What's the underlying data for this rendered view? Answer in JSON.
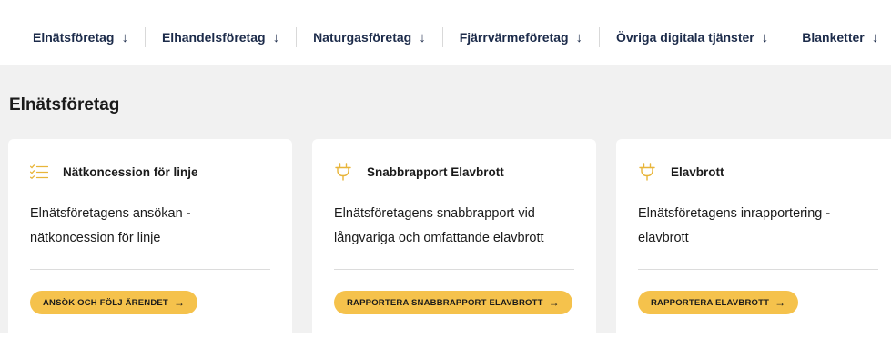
{
  "nav": {
    "items": [
      {
        "label": "Elnätsföretag",
        "icon": "arrow-down-icon"
      },
      {
        "label": "Elhandelsföretag",
        "icon": "arrow-down-icon"
      },
      {
        "label": "Naturgasföretag",
        "icon": "arrow-down-icon"
      },
      {
        "label": "Fjärrvärmeföretag",
        "icon": "arrow-down-icon"
      },
      {
        "label": "Övriga digitala tjänster",
        "icon": "arrow-down-icon"
      },
      {
        "label": "Blanketter",
        "icon": "arrow-down-icon"
      }
    ],
    "arrow_glyph": "↓"
  },
  "section": {
    "title": "Elnätsföretag"
  },
  "cards": [
    {
      "icon": "checklist-icon",
      "title": "Nätkoncession för linje",
      "description": "Elnätsföretagens ansökan - nätkoncession för linje",
      "button": "ANSÖK OCH FÖLJ ÄRENDET",
      "button_arrow": "→"
    },
    {
      "icon": "plug-icon",
      "title": "Snabbrapport Elavbrott",
      "description": "Elnätsföretagens snabbrapport vid långvariga och omfattande elavbrott",
      "button": "RAPPORTERA SNABBRAPPORT ELAVBROTT",
      "button_arrow": "→"
    },
    {
      "icon": "plug-icon",
      "title": "Elavbrott",
      "description": "Elnätsföretagens inrapportering - elavbrott",
      "button": "RAPPORTERA ELAVBROTT",
      "button_arrow": "→"
    }
  ],
  "colors": {
    "accent": "#f5c24c",
    "icon": "#e8b53a",
    "nav_text": "#1c2b4a",
    "background": "#f1f1f1"
  }
}
